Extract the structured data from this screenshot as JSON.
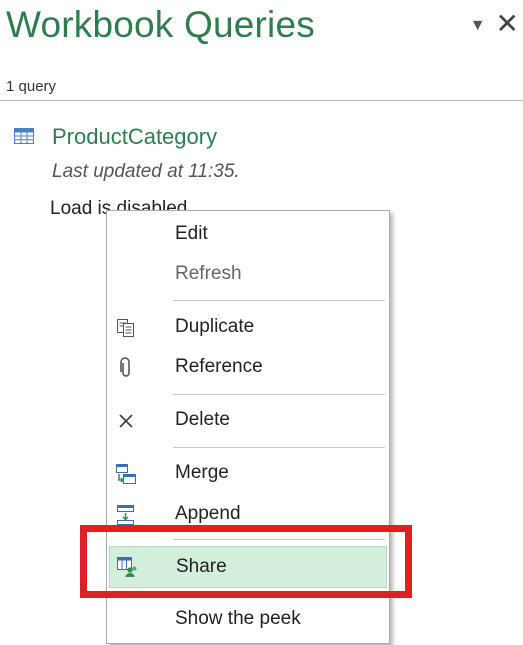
{
  "pane": {
    "title": "Workbook Queries",
    "query_count": "1 query"
  },
  "query": {
    "name": "ProductCategory",
    "updated": "Last updated at 11:35.",
    "load_status": "Load is disabled."
  },
  "context_menu": {
    "items": [
      {
        "label": "Edit",
        "icon": "",
        "enabled": true
      },
      {
        "label": "Refresh",
        "icon": "",
        "enabled": false
      },
      {
        "label": "Duplicate",
        "icon": "duplicate-icon",
        "enabled": true
      },
      {
        "label": "Reference",
        "icon": "paperclip-icon",
        "enabled": true
      },
      {
        "label": "Delete",
        "icon": "delete-x-icon",
        "enabled": true
      },
      {
        "label": "Merge",
        "icon": "merge-icon",
        "enabled": true
      },
      {
        "label": "Append",
        "icon": "append-icon",
        "enabled": true
      },
      {
        "label": "Share",
        "icon": "share-icon",
        "enabled": true,
        "highlighted": true
      },
      {
        "label": "Show the peek",
        "icon": "",
        "enabled": true
      }
    ]
  },
  "colors": {
    "title_green": "#2e7d4f",
    "highlight_green": "#d3eedb",
    "callout_red": "#dd1f26"
  }
}
